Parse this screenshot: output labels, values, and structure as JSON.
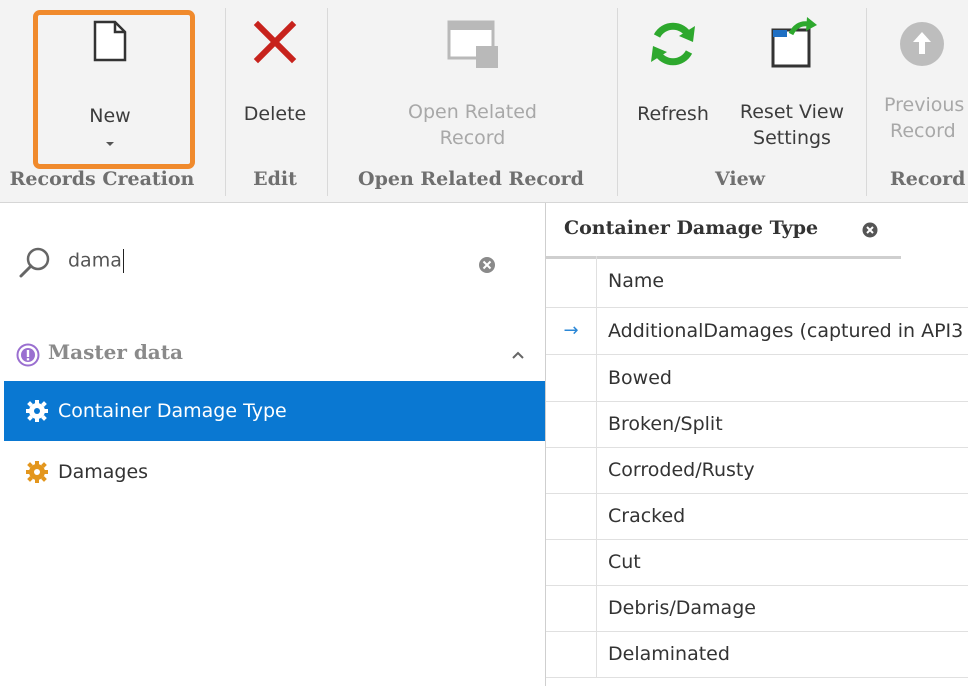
{
  "ribbon": {
    "groups": {
      "records_creation": "Records Creation",
      "edit": "Edit",
      "open_related_record": "Open Related Record",
      "view": "View",
      "record": "Record"
    },
    "buttons": {
      "new": "New",
      "delete": "Delete",
      "open_related_line1": "Open Related",
      "open_related_line2": "Record",
      "refresh": "Refresh",
      "reset_line1": "Reset View",
      "reset_line2": "Settings",
      "previous_line1": "Previous",
      "previous_line2": "Record"
    },
    "highlight_color": "#f08a2c"
  },
  "search": {
    "value": "dama"
  },
  "navigator": {
    "section": "Master data",
    "items": [
      {
        "label": "Container Damage Type",
        "selected": true
      },
      {
        "label": "Damages",
        "selected": false
      }
    ],
    "selected_color": "#0a78d2"
  },
  "document_tab": {
    "title": "Container Damage Type"
  },
  "grid": {
    "column_header": "Name",
    "current_row_indicator": "→",
    "rows": [
      "AdditionalDamages (captured in API3",
      "Bowed",
      "Broken/Split",
      "Corroded/Rusty",
      "Cracked",
      "Cut",
      "Debris/Damage",
      "Delaminated"
    ]
  }
}
